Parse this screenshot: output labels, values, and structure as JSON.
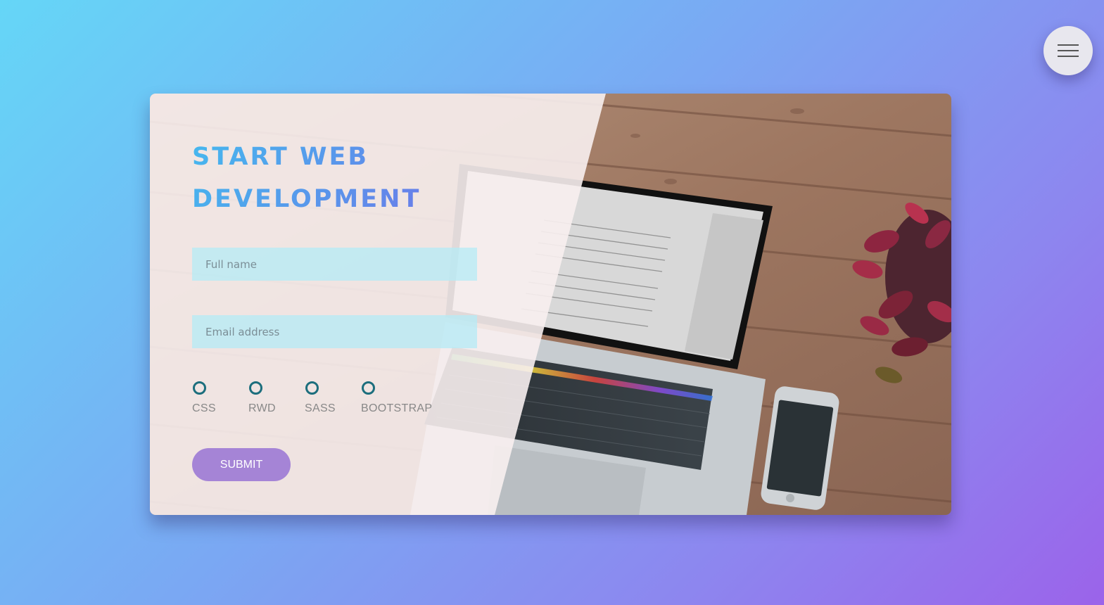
{
  "menu": {
    "icon": "hamburger-menu-icon"
  },
  "form": {
    "title_line1": "START WEB",
    "title_line2": "DEVELOPMENT",
    "name_placeholder": "Full name",
    "email_placeholder": "Email address",
    "options": [
      "CSS",
      "RWD",
      "SASS",
      "BOOTSTRAP"
    ],
    "submit_label": "SUBMIT"
  },
  "colors": {
    "title_gradient_start": "#45b8ee",
    "title_gradient_end": "#8d5fe6",
    "submit_button": "#a584d6",
    "radio_ring": "#1c6e7d",
    "input_background": "#b4ebf5"
  }
}
